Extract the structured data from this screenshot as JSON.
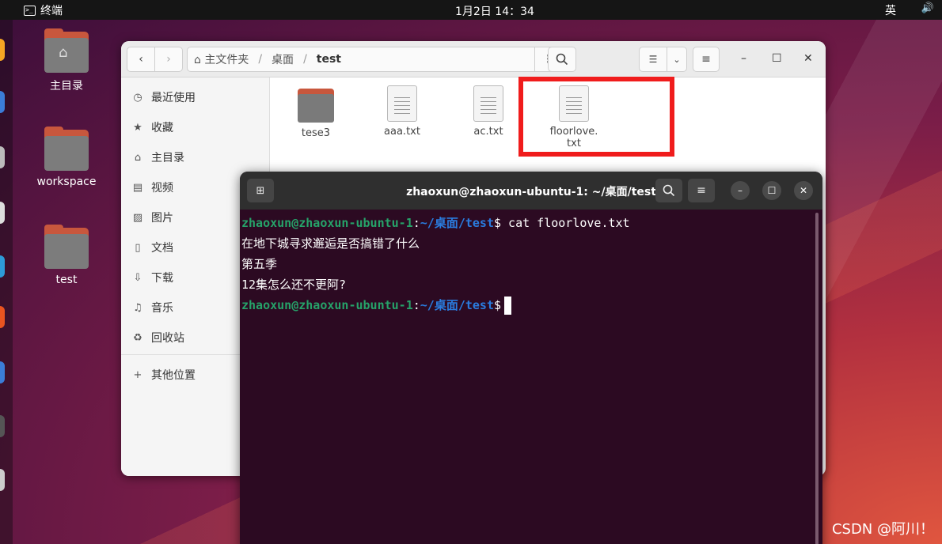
{
  "topbar": {
    "app_name": "终端",
    "app_icon": "terminal-icon",
    "clock": "1月2日  14：34",
    "input_method": "英",
    "volume_icon": "speaker-icon"
  },
  "desktop": {
    "icons": [
      {
        "label": "主目录",
        "icon": "home-folder-icon"
      },
      {
        "label": "workspace",
        "icon": "folder-icon"
      },
      {
        "label": "test",
        "icon": "folder-icon"
      }
    ]
  },
  "file_manager": {
    "path": {
      "home": "主文件夹",
      "desktop": "桌面",
      "current": "test"
    },
    "sidebar": [
      {
        "label": "最近使用",
        "icon": "clock-icon"
      },
      {
        "label": "收藏",
        "icon": "star-icon"
      },
      {
        "label": "主目录",
        "icon": "home-icon"
      },
      {
        "label": "视频",
        "icon": "video-icon"
      },
      {
        "label": "图片",
        "icon": "image-icon"
      },
      {
        "label": "文档",
        "icon": "document-icon"
      },
      {
        "label": "下载",
        "icon": "download-icon"
      },
      {
        "label": "音乐",
        "icon": "music-icon"
      },
      {
        "label": "回收站",
        "icon": "trash-icon"
      },
      {
        "label": "其他位置",
        "icon": "plus-icon"
      }
    ],
    "files": [
      {
        "name": "tese3",
        "type": "folder"
      },
      {
        "name": "aaa.txt",
        "type": "text"
      },
      {
        "name": "ac.txt",
        "type": "text"
      },
      {
        "name_line1": "floorlove.",
        "name_line2": "txt",
        "type": "text"
      }
    ],
    "highlight_color": "#f01c1c"
  },
  "terminal": {
    "title": "zhaoxun@zhaoxun-ubuntu-1: ~/桌面/test",
    "prompt_user": "zhaoxun@zhaoxun-ubuntu-1",
    "prompt_colon": ":",
    "prompt_path": "~/桌面/test",
    "prompt_dollar": "$",
    "command": " cat floorlove.txt",
    "output": [
      "在地下城寻求邂逅是否搞错了什么",
      "第五季",
      "12集怎么还不更阿?"
    ],
    "user_color": "#26a269",
    "path_color": "#2a7bde"
  },
  "watermark": "CSDN @阿川！"
}
